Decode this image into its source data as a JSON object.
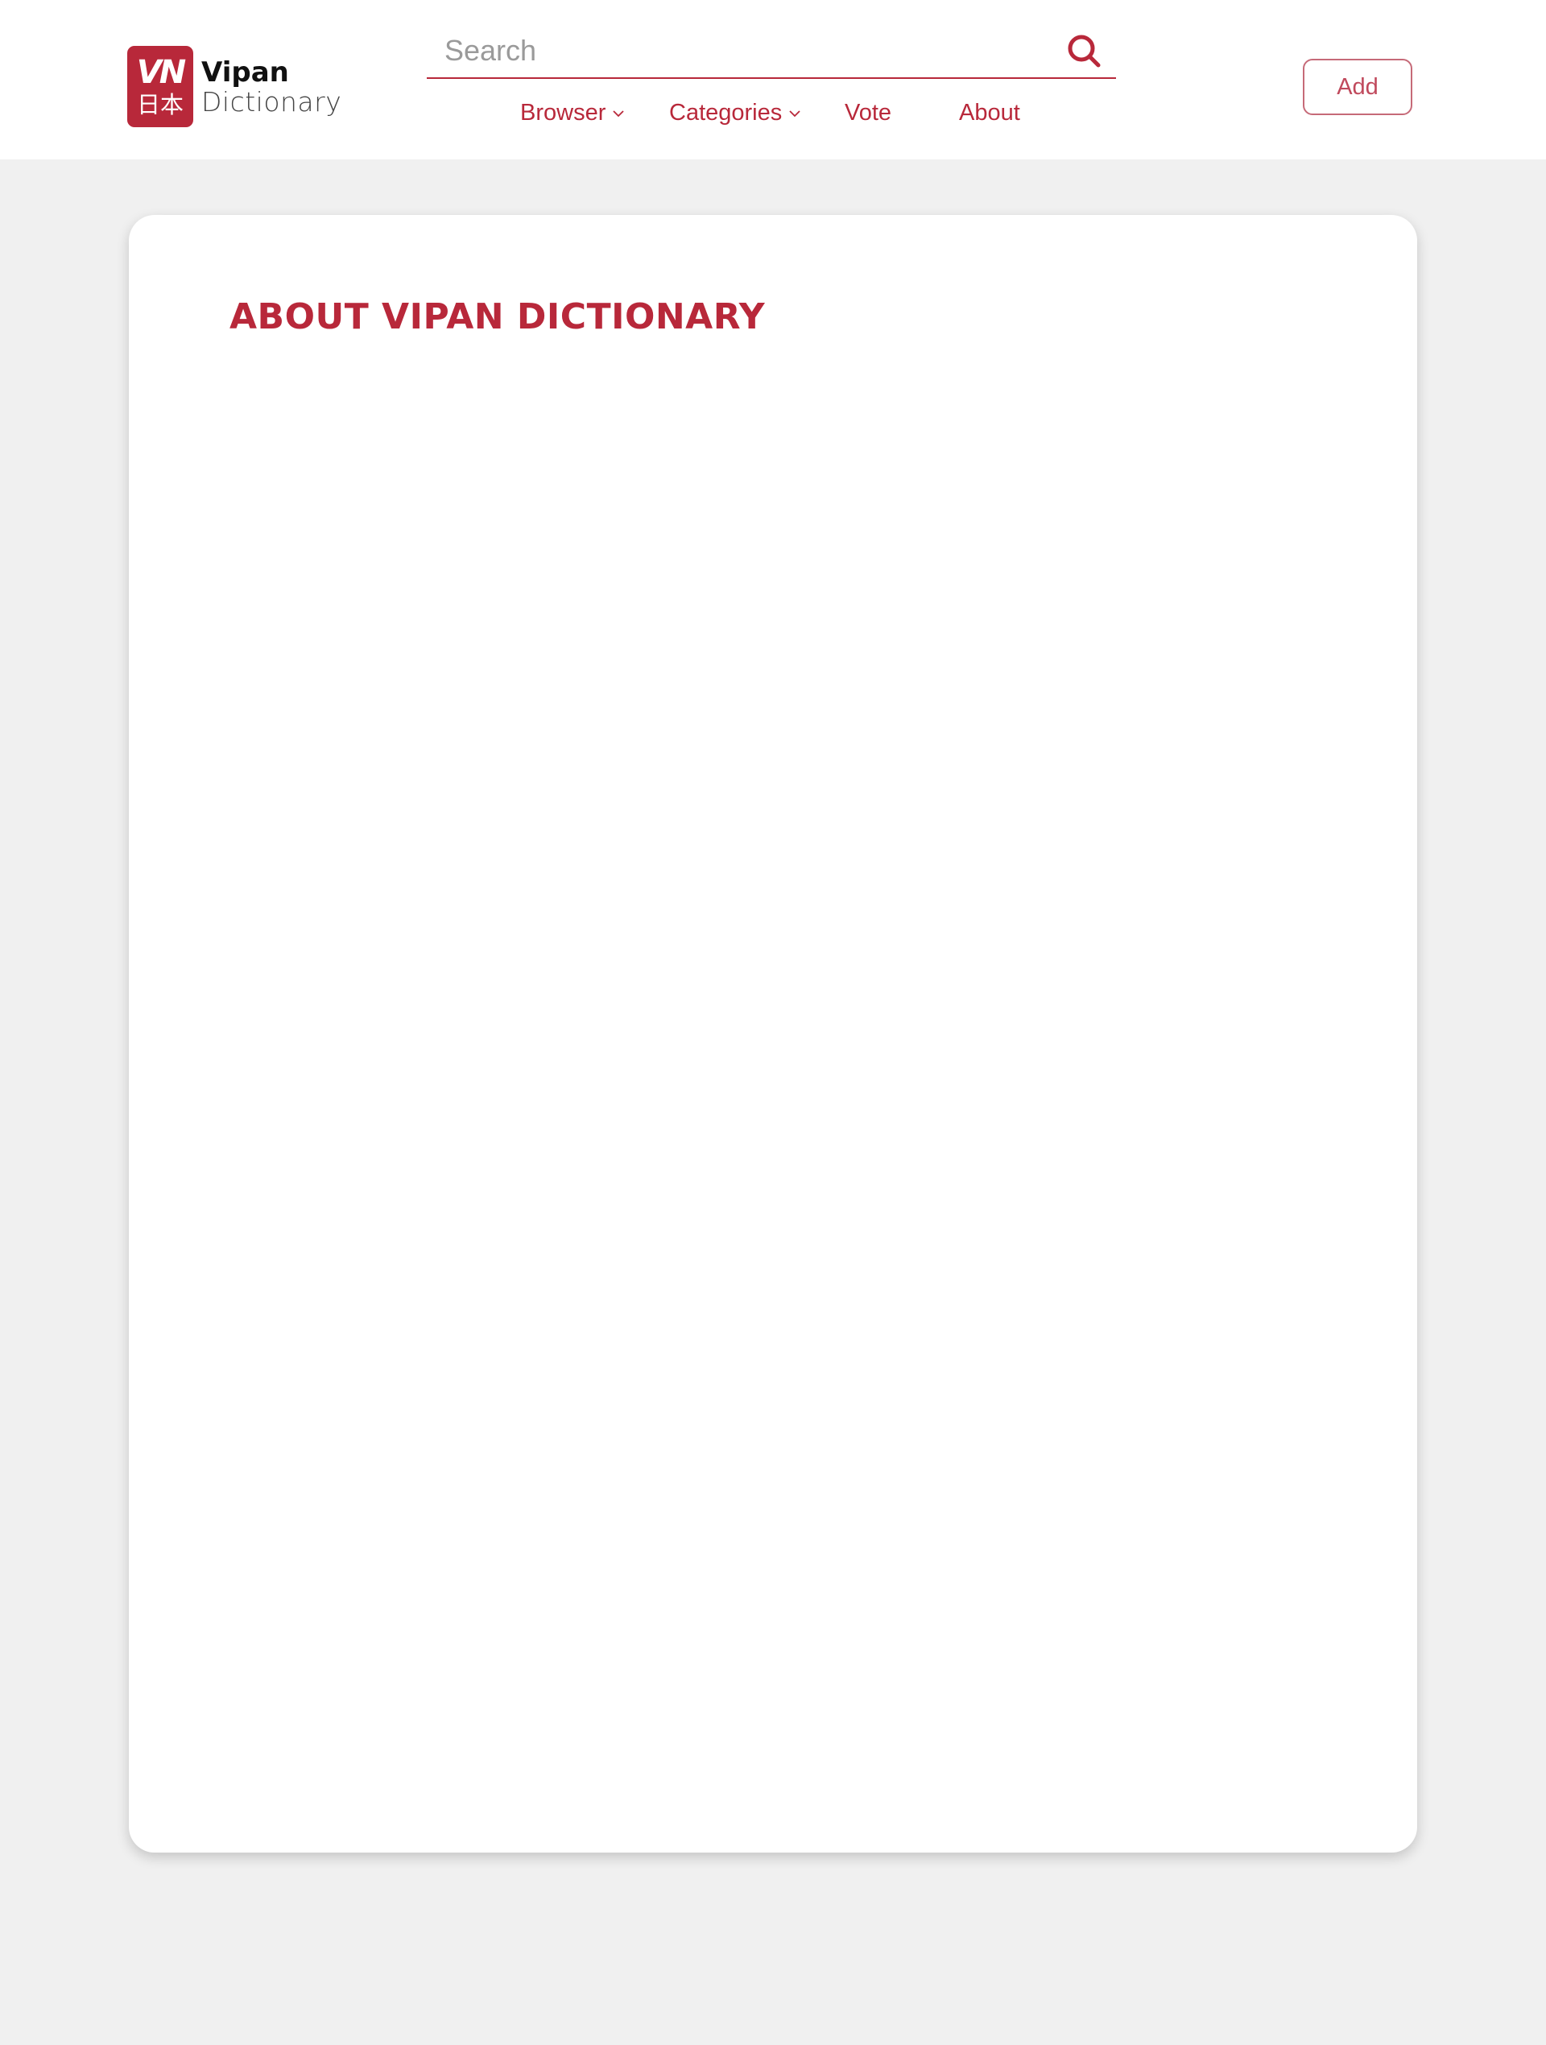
{
  "brand": {
    "mark_top": "VN",
    "mark_bottom": "日本",
    "title": "Vipan",
    "subtitle": "Dictionary"
  },
  "search": {
    "placeholder": "Search",
    "value": ""
  },
  "nav": {
    "browser_label": "Browser",
    "categories_label": "Categories",
    "vote_label": "Vote",
    "about_label": "About"
  },
  "actions": {
    "add_label": "Add"
  },
  "main": {
    "title": "ABOUT VIPAN DICTIONARY"
  },
  "icons": {
    "search": "search-icon",
    "dropdown": "chevron-down-icon"
  },
  "colors": {
    "brand": "#b8283a",
    "background": "#f0f0f0",
    "card": "#ffffff",
    "placeholder": "#9a9a9a"
  }
}
